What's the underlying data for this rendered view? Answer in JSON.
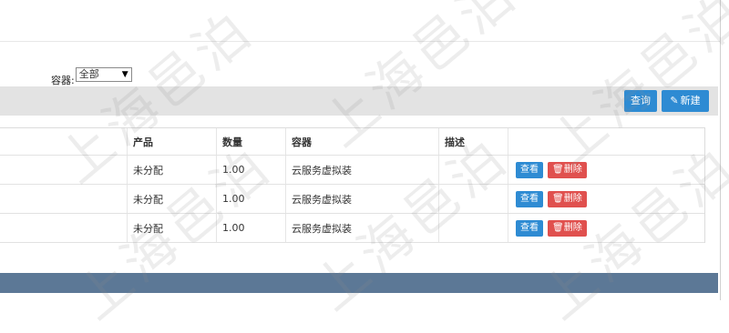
{
  "filter": {
    "container_label": "容器:",
    "container_value": "全部",
    "arrow": "▼"
  },
  "toolbar": {
    "query_label": "查询",
    "new_label": "新建",
    "new_icon": "pencil-icon"
  },
  "table": {
    "headers": {
      "product": "产品",
      "quantity": "数量",
      "container": "容器",
      "description": "描述"
    },
    "rows": [
      {
        "product": "未分配",
        "quantity": "1.00",
        "container": "云服务虚拟装",
        "description": ""
      },
      {
        "product": "未分配",
        "quantity": "1.00",
        "container": "云服务虚拟装",
        "description": ""
      },
      {
        "product": "未分配",
        "quantity": "1.00",
        "container": "云服务虚拟装",
        "description": ""
      }
    ],
    "view_label": "查看",
    "delete_label": "删除",
    "delete_icon": "trash-icon"
  },
  "watermark": "上海邑泊",
  "colors": {
    "primary": "#2e8bd3",
    "danger": "#e0504e",
    "toolbar_bg": "#e3e3e3",
    "footer_bg": "#5c7896"
  }
}
